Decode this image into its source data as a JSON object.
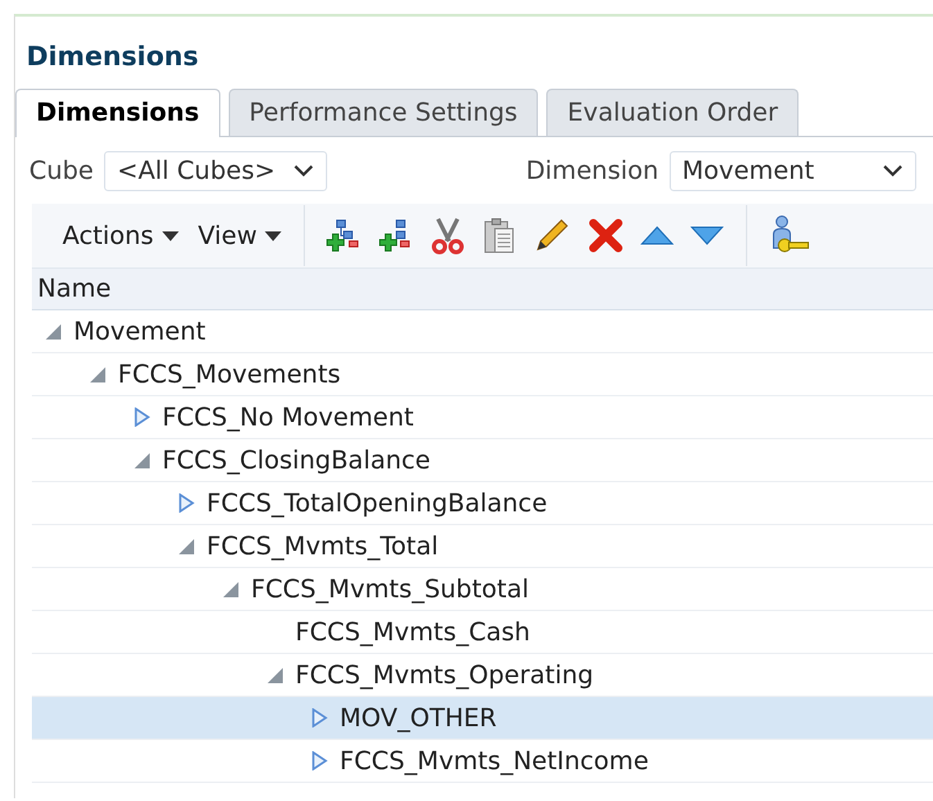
{
  "page_title": "Dimensions",
  "tabs": [
    {
      "label": "Dimensions",
      "selected": true
    },
    {
      "label": "Performance Settings",
      "selected": false
    },
    {
      "label": "Evaluation Order",
      "selected": false
    }
  ],
  "filters": [
    {
      "label": "Cube",
      "value": "<All Cubes>"
    },
    {
      "label": "Dimension",
      "value": "Movement"
    }
  ],
  "toolbar": {
    "menus": [
      "Actions",
      "View"
    ],
    "tools": [
      {
        "kind": "add-child"
      },
      {
        "kind": "add-sibling"
      },
      {
        "kind": "cut"
      },
      {
        "kind": "paste"
      },
      {
        "kind": "edit"
      },
      {
        "kind": "delete"
      },
      {
        "kind": "move-up"
      },
      {
        "kind": "move-down"
      },
      {
        "kind": "separator"
      },
      {
        "kind": "security"
      }
    ]
  },
  "tree": {
    "column": "Name",
    "nodes": [
      {
        "name": "Movement",
        "expanded": true,
        "selected": false,
        "children": [
          {
            "name": "FCCS_Movements",
            "expanded": true,
            "selected": false,
            "children": [
              {
                "name": "FCCS_No Movement",
                "expanded": false,
                "selected": false
              },
              {
                "name": "FCCS_ClosingBalance",
                "expanded": true,
                "selected": false,
                "children": [
                  {
                    "name": "FCCS_TotalOpeningBalance",
                    "expanded": false,
                    "selected": false
                  },
                  {
                    "name": "FCCS_Mvmts_Total",
                    "expanded": true,
                    "selected": false,
                    "children": [
                      {
                        "name": "FCCS_Mvmts_Subtotal",
                        "expanded": true,
                        "selected": false,
                        "children": [
                          {
                            "name": "FCCS_Mvmts_Cash",
                            "selected": false
                          },
                          {
                            "name": "FCCS_Mvmts_Operating",
                            "expanded": true,
                            "selected": false,
                            "children": [
                              {
                                "name": "MOV_OTHER",
                                "expanded": false,
                                "selected": true
                              },
                              {
                                "name": "FCCS_Mvmts_NetIncome",
                                "expanded": false,
                                "selected": false
                              }
                            ]
                          }
                        ]
                      }
                    ]
                  }
                ]
              }
            ]
          }
        ]
      }
    ]
  }
}
